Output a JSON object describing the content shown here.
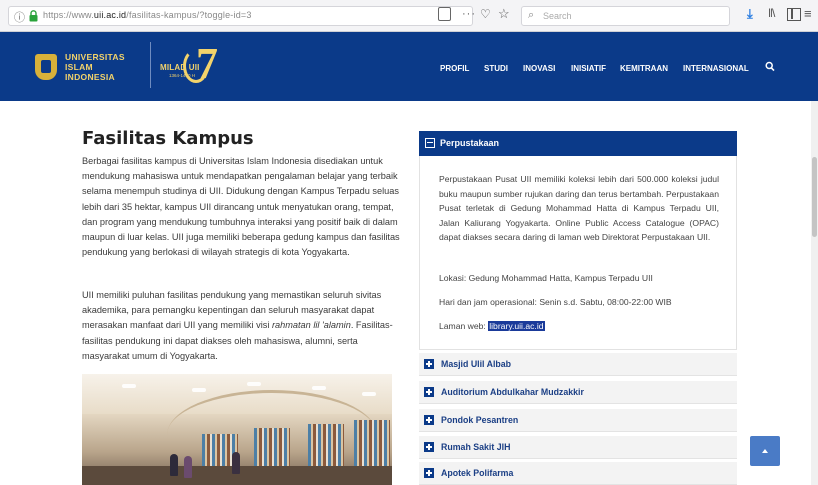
{
  "browser": {
    "url_prefix": "https://www.",
    "url_domain": "uii.ac.id",
    "url_path": "/fasilitas-kampus/?toggle-id=3",
    "search_placeholder": "Search"
  },
  "header": {
    "logo_line1": "UNIVERSITAS",
    "logo_line2": "ISLAM",
    "logo_line3": "INDONESIA",
    "milad_label": "MILAD UII",
    "milad_sub": "1364-1440 H",
    "milad_number": "7",
    "nav": [
      "PROFIL",
      "STUDI",
      "INOVASI",
      "INISIATIF",
      "KEMITRAAN",
      "INTERNASIONAL"
    ]
  },
  "article": {
    "title": "Fasilitas Kampus",
    "para1": "Berbagai fasilitas kampus di Universitas Islam Indonesia disediakan untuk mendukung mahasiswa untuk mendapatkan pengalaman belajar yang terbaik selama menempuh studinya di UII. Didukung dengan Kampus Terpadu seluas lebih dari 35 hektar, kampus UII dirancang untuk menyatukan orang, tempat, dan program yang mendukung tumbuhnya interaksi yang positif baik di dalam maupun di luar kelas. UII juga memiliki beberapa gedung kampus dan fasilitas pendukung yang berlokasi di wilayah strategis di kota Yogyakarta.",
    "para2_before": "UII memiliki puluhan fasilitas pendukung yang memastikan seluruh sivitas akademika, para pemangku kepentingan dan seluruh masyarakat dapat merasakan manfaat dari UII yang memiliki visi ",
    "para2_em": "rahmatan lil 'alamin",
    "para2_after": ". Fasilitas-fasilitas pendukung ini dapat diakses oleh mahasiswa, alumni, serta masyarakat umum di Yogyakarta."
  },
  "accordion": {
    "active": {
      "title": "Perpustakaan",
      "description": "Perpustakaan Pusat UII memiliki koleksi lebih dari 500.000 koleksi judul buku maupun sumber rujukan daring dan terus bertambah. Perpustakaan Pusat terletak di Gedung Mohammad Hatta di Kampus Terpadu UII, Jalan Kaliurang Yogyakarta. Online Public Access Catalogue (OPAC) dapat diakses secara daring di laman web Direktorat Perpustakaan UII.",
      "lokasi": "Lokasi: Gedung Mohammad Hatta, Kampus Terpadu UII",
      "hari": "Hari dan jam operasional: Senin s.d. Sabtu, 08:00-22:00 WIB",
      "laman_label": "Laman web: ",
      "laman_link": "library.uii.ac.id"
    },
    "items": [
      "Masjid Ulil Albab",
      "Auditorium Abdulkahar Mudzakkir",
      "Pondok Pesantren",
      "Rumah Sakit JIH",
      "Apotek Polifarma"
    ]
  },
  "colors": {
    "brand_blue": "#0b3a89",
    "logo_gold": "#f3d36b",
    "link_highlight": "#1a3a9a"
  }
}
